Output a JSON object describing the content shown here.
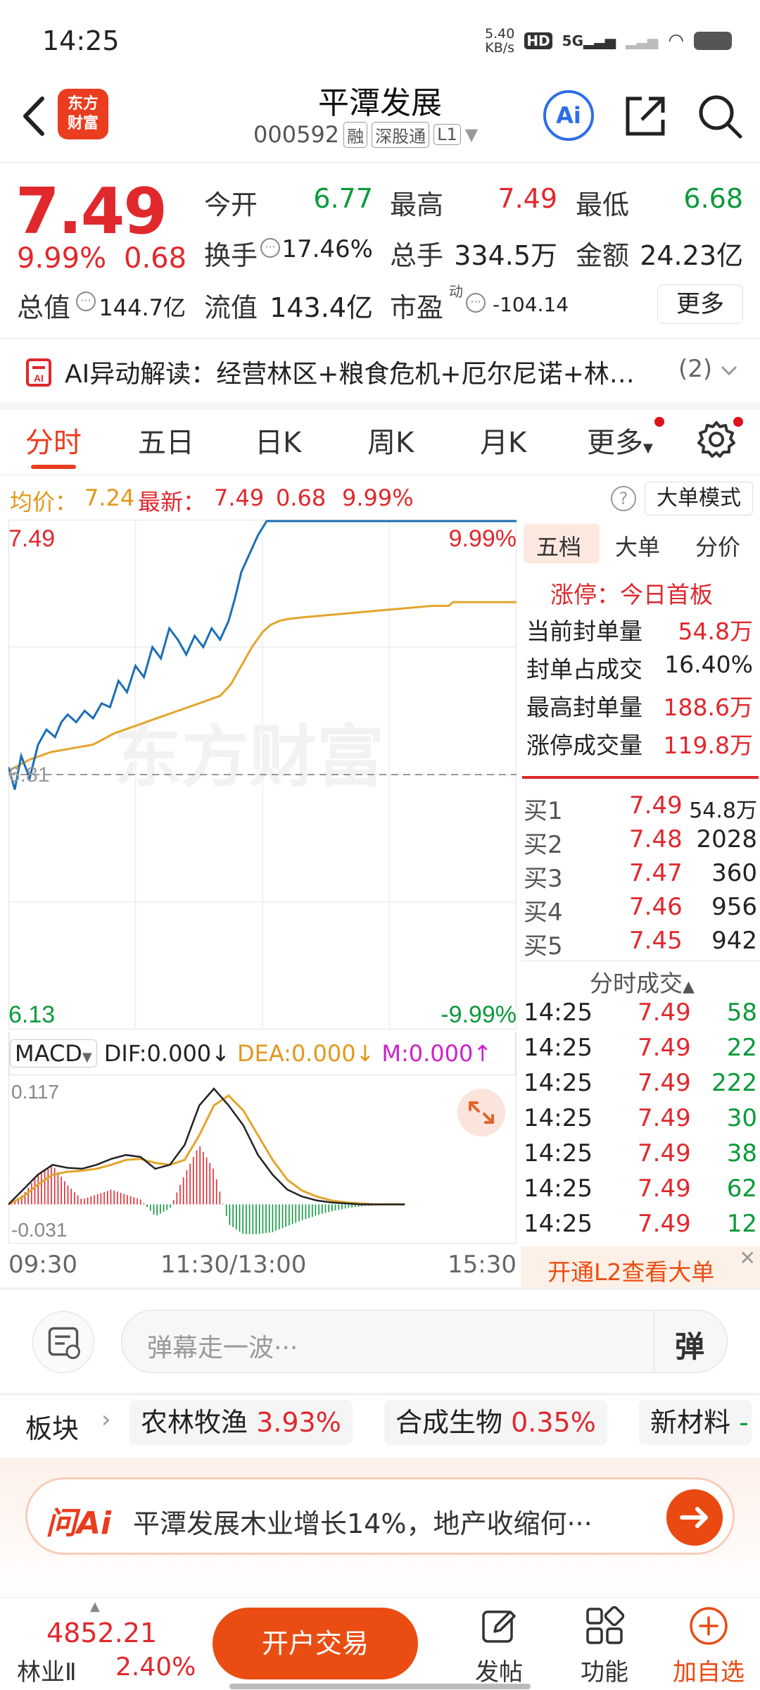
{
  "status_bar": {
    "time": "14:25",
    "speed_value": "5.40",
    "speed_unit": "KB/s",
    "network": "5G"
  },
  "header": {
    "logo_line1": "东方",
    "logo_line2": "财富",
    "stock_name": "平潭发展",
    "stock_code": "000592",
    "tag_margin": "融",
    "tag_connect": "深股通",
    "tag_level": "L1",
    "ai_label": "Ai"
  },
  "quote": {
    "price": "7.49",
    "change_pct": "9.99%",
    "change": "0.68",
    "open_label": "今开",
    "open": "6.77",
    "high_label": "最高",
    "high": "7.49",
    "low_label": "最低",
    "low": "6.68",
    "turnover_label": "换手",
    "turnover": "17.46%",
    "volume_label": "总手",
    "volume": "334.5万",
    "amount_label": "金额",
    "amount": "24.23亿",
    "mcap_label": "总值",
    "mcap": "144.7亿",
    "float_label": "流值",
    "float_cap": "143.4亿",
    "pe_label": "市盈",
    "pe_sup": "动",
    "pe": "-104.14",
    "more_label": "更多"
  },
  "ai_banner": {
    "text": "AI异动解读：经营林区+粮食危机+厄尔尼诺+林…",
    "count": "(2)"
  },
  "tabs": [
    {
      "label": "分时",
      "active": true
    },
    {
      "label": "五日"
    },
    {
      "label": "日K"
    },
    {
      "label": "周K"
    },
    {
      "label": "月K"
    },
    {
      "label": "更多"
    }
  ],
  "avg_info": {
    "avg_label": "均价：",
    "avg": "7.24",
    "latest_label": "最新：",
    "latest": "7.49",
    "change": "0.68",
    "pct": "9.99%",
    "big_order_mode": "大单模式"
  },
  "chart_data": {
    "type": "line",
    "title": "",
    "x_range": [
      "09:30",
      "15:30"
    ],
    "ylim": [
      6.13,
      7.49
    ],
    "baseline": 6.81,
    "y_top_label": "7.49",
    "y_bottom_label": "6.13",
    "pct_top_label": "9.99%",
    "pct_bottom_label": "-9.99%",
    "baseline_label": "6.81",
    "watermark": "东方财富",
    "time_labels": [
      "09:30",
      "11:30/13:00",
      "15:30"
    ],
    "series": [
      {
        "name": "最新",
        "color": "#1a6fb5",
        "t": [
          0,
          3,
          6,
          10,
          14,
          18,
          22,
          25,
          28,
          32,
          36,
          40,
          44,
          48,
          52,
          56,
          60,
          64,
          68,
          72,
          76,
          80,
          84,
          88,
          92,
          96,
          100,
          104,
          107,
          110,
          114,
          118,
          122,
          130,
          140,
          160,
          200,
          240,
          280,
          300
        ],
        "values": [
          6.83,
          6.77,
          6.86,
          6.8,
          6.89,
          6.93,
          6.91,
          6.95,
          6.97,
          6.95,
          6.98,
          6.96,
          7.0,
          6.99,
          7.06,
          7.03,
          7.1,
          7.07,
          7.15,
          7.12,
          7.2,
          7.17,
          7.13,
          7.18,
          7.15,
          7.2,
          7.17,
          7.22,
          7.28,
          7.35,
          7.4,
          7.45,
          7.49,
          7.49,
          7.49,
          7.49,
          7.49,
          7.49,
          7.49,
          7.49
        ]
      },
      {
        "name": "均价",
        "color": "#e3a52a",
        "t": [
          0,
          10,
          20,
          30,
          40,
          50,
          60,
          70,
          80,
          90,
          100,
          105,
          110,
          115,
          120,
          124,
          128,
          132,
          140,
          150,
          160,
          170,
          180,
          190,
          200,
          208,
          210,
          220,
          240,
          260,
          280,
          300
        ],
        "values": [
          6.82,
          6.85,
          6.87,
          6.88,
          6.89,
          6.92,
          6.94,
          6.96,
          6.98,
          7.0,
          7.02,
          7.05,
          7.1,
          7.15,
          7.19,
          7.21,
          7.22,
          7.225,
          7.23,
          7.235,
          7.24,
          7.245,
          7.25,
          7.255,
          7.26,
          7.26,
          7.27,
          7.27,
          7.27,
          7.272,
          7.273,
          7.275
        ]
      }
    ],
    "macd": {
      "indicator": "MACD",
      "dif_label": "DIF:0.000",
      "dif_arrow": "↓",
      "dea_label": "DEA:0.000",
      "dea_arrow": "↓",
      "m_label": "M:0.000",
      "m_arrow": "↑",
      "ylim": [
        -0.031,
        0.117
      ],
      "y_top_label": "0.117",
      "y_bottom_label": "-0.031",
      "dif": [
        0.0,
        0.015,
        0.03,
        0.04,
        0.037,
        0.036,
        0.04,
        0.046,
        0.05,
        0.048,
        0.036,
        0.04,
        0.06,
        0.1,
        0.117,
        0.1,
        0.08,
        0.05,
        0.03,
        0.015,
        0.008,
        0.004,
        0.002,
        0.001,
        0.0,
        0.0,
        0.0,
        0.0
      ],
      "dea": [
        0.0,
        0.008,
        0.02,
        0.03,
        0.033,
        0.034,
        0.036,
        0.04,
        0.045,
        0.046,
        0.042,
        0.04,
        0.045,
        0.07,
        0.1,
        0.11,
        0.095,
        0.07,
        0.045,
        0.025,
        0.014,
        0.008,
        0.004,
        0.002,
        0.001,
        0.0,
        0.0,
        0.0
      ],
      "hist": [
        0.0,
        0.01,
        0.03,
        0.04,
        0.02,
        0.005,
        0.01,
        0.015,
        0.01,
        0.005,
        -0.012,
        -0.004,
        0.03,
        0.06,
        0.035,
        -0.02,
        -0.03,
        -0.03,
        -0.028,
        -0.022,
        -0.016,
        -0.011,
        -0.007,
        -0.004,
        -0.002,
        -0.001,
        0.0,
        0.0
      ]
    }
  },
  "right_panel": {
    "tabs": [
      {
        "label": "五档",
        "active": true
      },
      {
        "label": "大单"
      },
      {
        "label": "分价"
      }
    ],
    "limit_title": "涨停：今日首板",
    "stats": [
      {
        "label": "当前封单量",
        "value": "54.8万",
        "color": "red"
      },
      {
        "label": "封单占成交",
        "value": "16.40%",
        "color": "dark"
      },
      {
        "label": "最高封单量",
        "value": "188.6万",
        "color": "red"
      },
      {
        "label": "涨停成交量",
        "value": "119.8万",
        "color": "red"
      }
    ],
    "bids": [
      {
        "label": "买1",
        "price": "7.49",
        "vol": "54.8万"
      },
      {
        "label": "买2",
        "price": "7.48",
        "vol": "2028"
      },
      {
        "label": "买3",
        "price": "7.47",
        "vol": "360"
      },
      {
        "label": "买4",
        "price": "7.46",
        "vol": "956"
      },
      {
        "label": "买5",
        "price": "7.45",
        "vol": "942"
      }
    ],
    "ticks_title": "分时成交",
    "ticks": [
      {
        "time": "14:25",
        "price": "7.49",
        "vol": "58"
      },
      {
        "time": "14:25",
        "price": "7.49",
        "vol": "22"
      },
      {
        "time": "14:25",
        "price": "7.49",
        "vol": "222"
      },
      {
        "time": "14:25",
        "price": "7.49",
        "vol": "30"
      },
      {
        "time": "14:25",
        "price": "7.49",
        "vol": "38"
      },
      {
        "time": "14:25",
        "price": "7.49",
        "vol": "62"
      },
      {
        "time": "14:25",
        "price": "7.49",
        "vol": "12"
      }
    ],
    "l2_promo": "开通L2查看大单"
  },
  "danmu": {
    "placeholder": "弹幕走一波···",
    "toggle_label": "弹"
  },
  "sectors": {
    "label": "板块",
    "items": [
      {
        "name": "农林牧渔",
        "pct": "3.93%"
      },
      {
        "name": "合成生物",
        "pct": "0.35%"
      },
      {
        "name": "新材料",
        "pct": "-"
      }
    ]
  },
  "ai_ask": {
    "logo": "问Ai",
    "text": "平潭发展木业增长14%，地产收缩何···"
  },
  "bottom_bar": {
    "index_value": "4852.21",
    "index_name": "林业Ⅱ",
    "index_pct": "2.40%",
    "open_trade": "开户交易",
    "items": [
      {
        "label": "发帖"
      },
      {
        "label": "功能"
      },
      {
        "label": "加自选"
      }
    ]
  }
}
